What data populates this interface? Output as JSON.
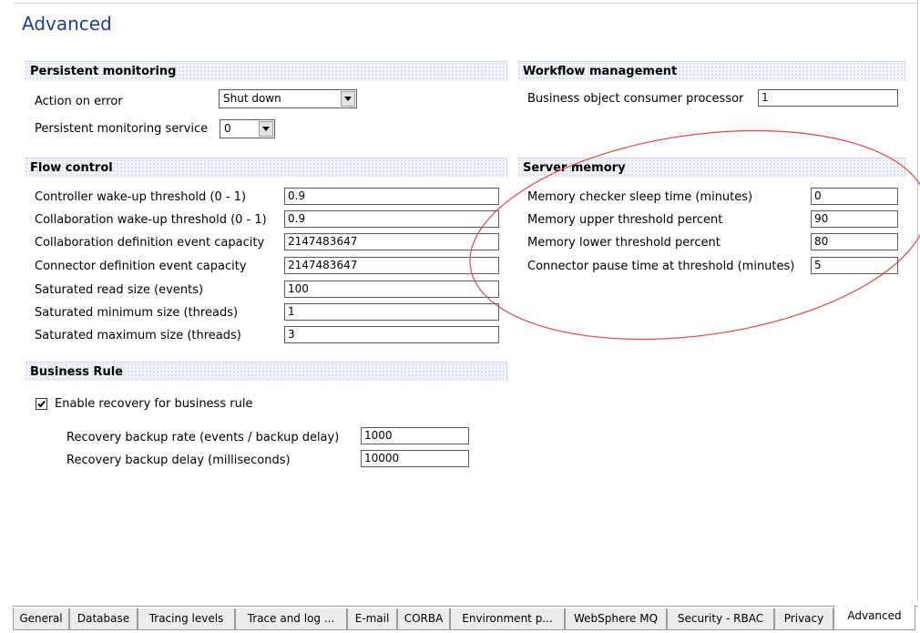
{
  "page": {
    "title": "Advanced"
  },
  "persistent_monitoring": {
    "header": "Persistent monitoring",
    "action_on_error": {
      "label": "Action on error",
      "value": "Shut down"
    },
    "service": {
      "label": "Persistent monitoring service",
      "value": "0"
    }
  },
  "workflow_management": {
    "header": "Workflow management",
    "consumer_processor": {
      "label": "Business object consumer processor",
      "value": "1"
    }
  },
  "flow_control": {
    "header": "Flow control",
    "fields": [
      {
        "label": "Controller wake-up threshold (0 - 1)",
        "value": "0.9"
      },
      {
        "label": "Collaboration wake-up threshold (0 - 1)",
        "value": "0.9"
      },
      {
        "label": "Collaboration definition event capacity",
        "value": "2147483647"
      },
      {
        "label": "Connector definition event capacity",
        "value": "2147483647"
      },
      {
        "label": "Saturated read size (events)",
        "value": "100"
      },
      {
        "label": "Saturated minimum size (threads)",
        "value": "1"
      },
      {
        "label": "Saturated maximum size (threads)",
        "value": "3"
      }
    ]
  },
  "server_memory": {
    "header": "Server memory",
    "fields": [
      {
        "label": "Memory checker sleep time (minutes)",
        "value": "0"
      },
      {
        "label": "Memory upper threshold percent",
        "value": "90"
      },
      {
        "label": "Memory lower threshold percent",
        "value": "80"
      },
      {
        "label": "Connector pause time at threshold (minutes)",
        "value": "5"
      }
    ]
  },
  "business_rule": {
    "header": "Business Rule",
    "enable_recovery": {
      "label": "Enable recovery for business rule",
      "checked": true
    },
    "fields": [
      {
        "label": "Recovery backup rate (events / backup delay)",
        "value": "1000"
      },
      {
        "label": "Recovery backup delay (milliseconds)",
        "value": "10000"
      }
    ]
  },
  "tabs": [
    {
      "label": "General"
    },
    {
      "label": "Database"
    },
    {
      "label": "Tracing levels"
    },
    {
      "label": "Trace and log ..."
    },
    {
      "label": "E-mail"
    },
    {
      "label": "CORBA"
    },
    {
      "label": "Environment p..."
    },
    {
      "label": "WebSphere MQ"
    },
    {
      "label": "Security - RBAC"
    },
    {
      "label": "Privacy"
    },
    {
      "label": "Advanced",
      "active": true
    }
  ],
  "icons": {
    "dropdown": "triangle-down-icon",
    "checkbox": "checkmark-icon"
  },
  "colors": {
    "title": "#1f3f86",
    "annotation_ring": "#e0454a",
    "section_bg": "#f3f5fb"
  }
}
